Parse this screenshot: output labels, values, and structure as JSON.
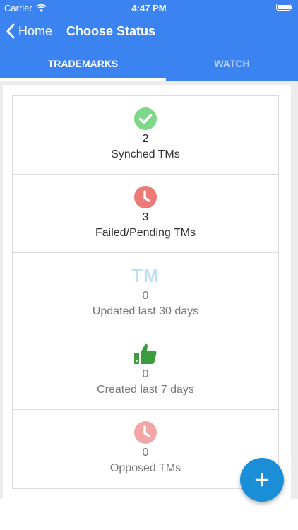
{
  "status_bar": {
    "carrier": "Carrier",
    "time": "4:47 PM"
  },
  "nav": {
    "back_label": "Home",
    "title": "Choose Status"
  },
  "tabs": [
    {
      "label": "TRADEMARKS",
      "active": true
    },
    {
      "label": "WATCH",
      "active": false
    }
  ],
  "cards": [
    {
      "count": "2",
      "label": "Synched TMs",
      "icon": "check-circle-icon",
      "color": "#7ed88a"
    },
    {
      "count": "3",
      "label": "Failed/Pending TMs",
      "icon": "clock-icon",
      "color": "#ee7a78"
    },
    {
      "count": "0",
      "label": "Updated last 30 days",
      "icon": "TM",
      "color": "#bfe0ee"
    },
    {
      "count": "0",
      "label": "Created last 7 days",
      "icon": "thumbs-up-icon",
      "color": "#3c9b3f"
    },
    {
      "count": "0",
      "label": "Opposed TMs",
      "icon": "clock-icon",
      "color": "#f2a7a6"
    }
  ],
  "fab": {
    "icon": "plus-icon",
    "color": "#1a8fd8"
  },
  "colors": {
    "accent": "#3b83f0"
  }
}
